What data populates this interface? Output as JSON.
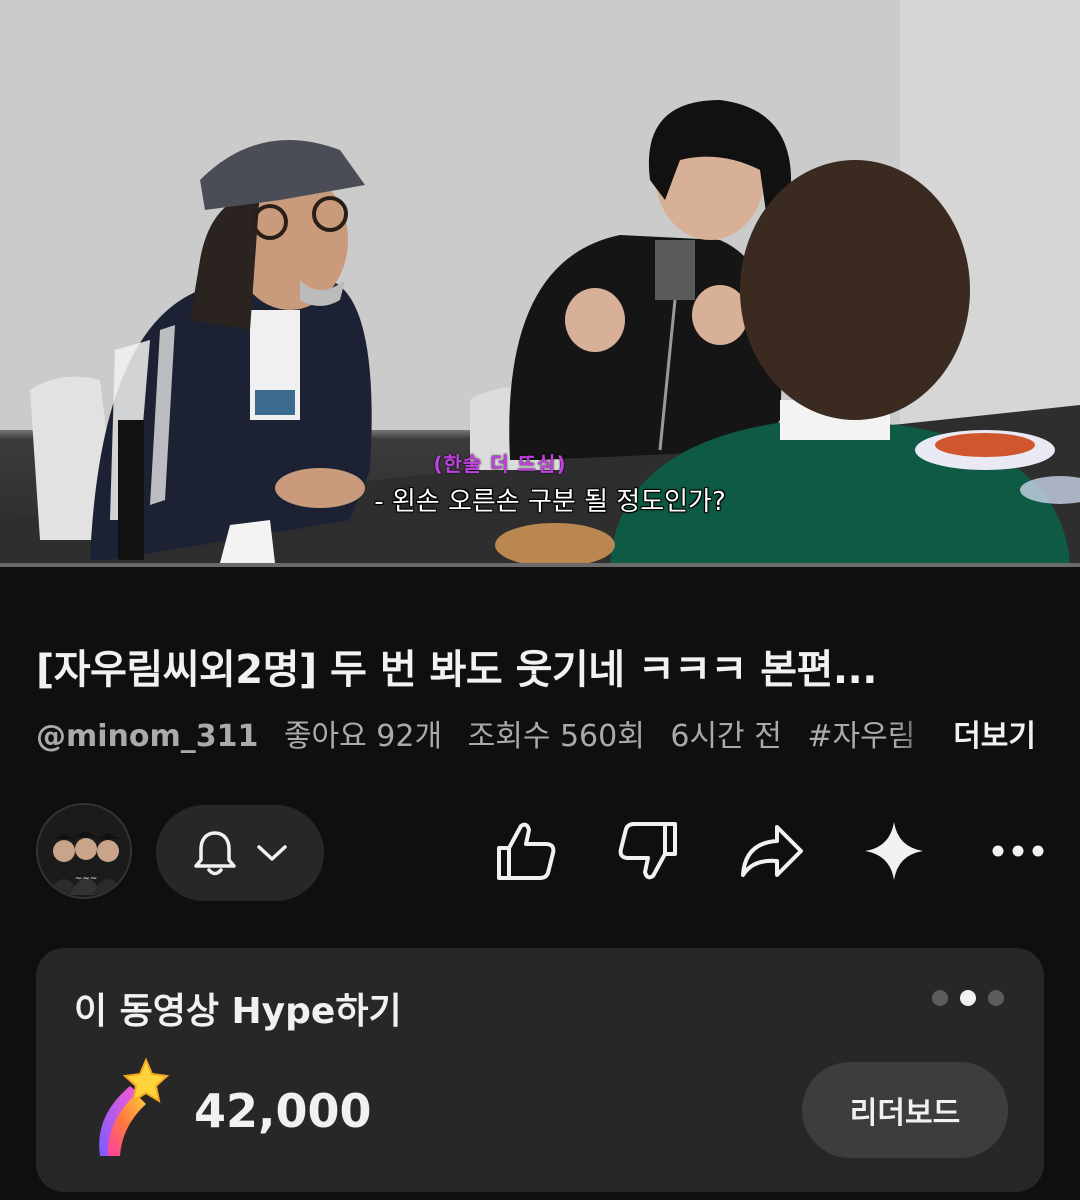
{
  "video": {
    "subtitle_small": "(한술 더 뜨심)",
    "subtitle_main": "- 왼손 오른손 구분 될 정도인가?",
    "progress_fraction": 0.0
  },
  "title": "[자우림씨외2명] 두 번 봐도 웃기네 ㅋㅋㅋ 본편...",
  "meta": {
    "handle": "@minom_311",
    "likes": "좋아요 92개",
    "views": "조회수 560회",
    "time": "6시간 전",
    "hashtag": "#자우림",
    "more": "더보기"
  },
  "actions": {
    "like": "like-icon",
    "dislike": "dislike-icon",
    "share": "share-icon",
    "ask": "sparkle-icon",
    "more": "more-icon"
  },
  "hype": {
    "title": "이 동영상 Hype하기",
    "count": "42,000",
    "leaderboard_label": "리더보드",
    "page_index": 2,
    "page_count": 3
  },
  "colors": {
    "background": "#0f0f0f",
    "card": "#272727",
    "subtitle_accent": "#c040e0"
  }
}
